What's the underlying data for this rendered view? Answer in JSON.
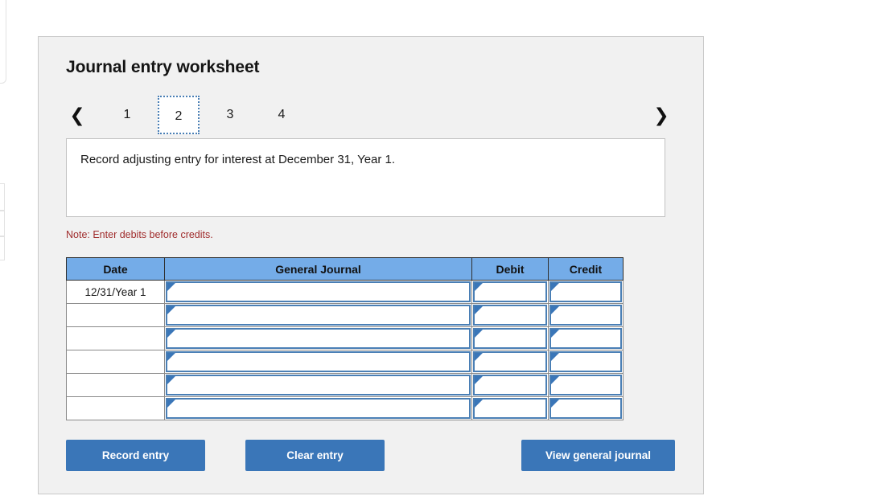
{
  "panel": {
    "title": "Journal entry worksheet"
  },
  "tabs": {
    "prev_icon": "chevron-left-icon",
    "next_icon": "chevron-right-icon",
    "items": [
      {
        "label": "1",
        "active": false
      },
      {
        "label": "2",
        "active": true
      },
      {
        "label": "3",
        "active": false
      },
      {
        "label": "4",
        "active": false
      }
    ]
  },
  "instruction": {
    "text": "Record adjusting entry for interest at December 31, Year 1."
  },
  "note": {
    "text": "Note: Enter debits before credits.",
    "color": "#a02c2c"
  },
  "table": {
    "headers": {
      "date": "Date",
      "general_journal": "General Journal",
      "debit": "Debit",
      "credit": "Credit"
    },
    "rows": [
      {
        "date": "12/31/Year 1",
        "general_journal": "",
        "debit": "",
        "credit": ""
      },
      {
        "date": "",
        "general_journal": "",
        "debit": "",
        "credit": ""
      },
      {
        "date": "",
        "general_journal": "",
        "debit": "",
        "credit": ""
      },
      {
        "date": "",
        "general_journal": "",
        "debit": "",
        "credit": ""
      },
      {
        "date": "",
        "general_journal": "",
        "debit": "",
        "credit": ""
      },
      {
        "date": "",
        "general_journal": "",
        "debit": "",
        "credit": ""
      }
    ],
    "header_color": "#74ace8",
    "cell_border_color": "#4a7fb5"
  },
  "buttons": {
    "record": "Record entry",
    "clear": "Clear entry",
    "view": "View general journal",
    "color": "#3a76b8"
  }
}
